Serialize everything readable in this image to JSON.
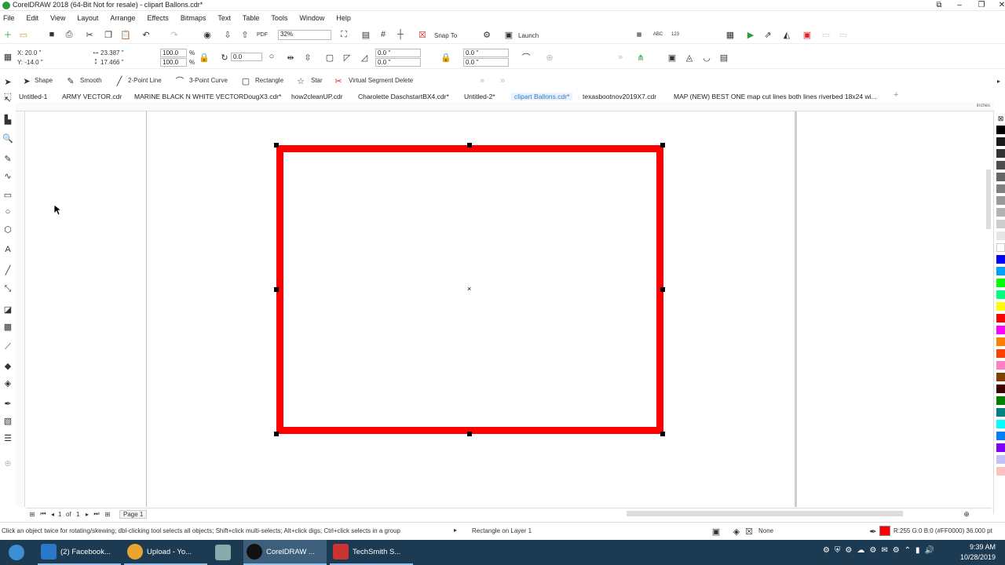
{
  "window": {
    "title": "CorelDRAW 2018 (64-Bit Not for resale) - clipart Ballons.cdr*"
  },
  "menu": [
    "File",
    "Edit",
    "View",
    "Layout",
    "Arrange",
    "Effects",
    "Bitmaps",
    "Text",
    "Table",
    "Tools",
    "Window",
    "Help"
  ],
  "standard_toolbar": {
    "zoom": "32%",
    "snap_to": "Snap To",
    "launch": "Launch"
  },
  "property_bar": {
    "x": "X: 20.0 \"",
    "y": "Y: -14.0 \"",
    "width": "23.387 \"",
    "height": "17.466 \"",
    "scale_w": "100.0",
    "scale_h": "100.0",
    "percent": "%",
    "rotation": "0.0",
    "corner_1": "0.0 \"",
    "corner_2": "0.0 \"",
    "corner_3": "0.0 \"",
    "corner_4": "0.0 \""
  },
  "shape_toolbar": [
    "Shape",
    "Smooth",
    "2-Point Line",
    "3-Point Curve",
    "Rectangle",
    "Star",
    "Virtual Segment Delete"
  ],
  "tabs": [
    {
      "label": "Untitled-1",
      "active": false
    },
    {
      "label": "ARMY VECTOR.cdr",
      "active": false
    },
    {
      "label": "MARINE BLACK N WHITE VECTORDougX3.cdr*",
      "active": false
    },
    {
      "label": "how2cleanUP.cdr",
      "active": false
    },
    {
      "label": "Charolette DaschstartBX4.cdr*",
      "active": false
    },
    {
      "label": "Untitled-2*",
      "active": false
    },
    {
      "label": "clipart Ballons.cdr*",
      "active": true
    },
    {
      "label": "texasbootnov2019X7.cdr",
      "active": false
    },
    {
      "label": "MAP (NEW) BEST ONE map cut lines both lines  riverbed 18x24 wi...",
      "active": false
    }
  ],
  "ruler_unit": "inches",
  "page_nav": {
    "current": "1",
    "of": "of",
    "total": "1",
    "page_tab": "Page 1"
  },
  "status": {
    "hint": "Click an object twice for rotating/skewing; dbl-clicking tool selects all objects; Shift+click multi-selects; Alt+click digs; Ctrl+click selects in a group",
    "object": "Rectangle on Layer 1",
    "fill": "None",
    "outline": "R:255 G:0 B:0 (#FF0000)  36.000 pt"
  },
  "colors": {
    "rectangle_outline": "#FF0000"
  },
  "palette": [
    "#000000",
    "#1a1a1a",
    "#333333",
    "#4d4d4d",
    "#666666",
    "#808080",
    "#999999",
    "#b3b3b3",
    "#cccccc",
    "#e6e6e6",
    "#ffffff",
    "#0000ff",
    "#00a0ff",
    "#00ff00",
    "#00ff80",
    "#ffff00",
    "#ff0000",
    "#ff00ff",
    "#ff8000",
    "#ff4000",
    "#ff80c0",
    "#804000",
    "#400000",
    "#008000",
    "#008080",
    "#00ffff",
    "#0080ff",
    "#8000ff",
    "#c0c0ff",
    "#ffc0c0"
  ],
  "taskbar": {
    "items": [
      "(2) Facebook...",
      "Upload - Yo...",
      "",
      "CorelDRAW ...",
      "TechSmith S..."
    ],
    "time": "9:39 AM",
    "date": "10/28/2019"
  }
}
